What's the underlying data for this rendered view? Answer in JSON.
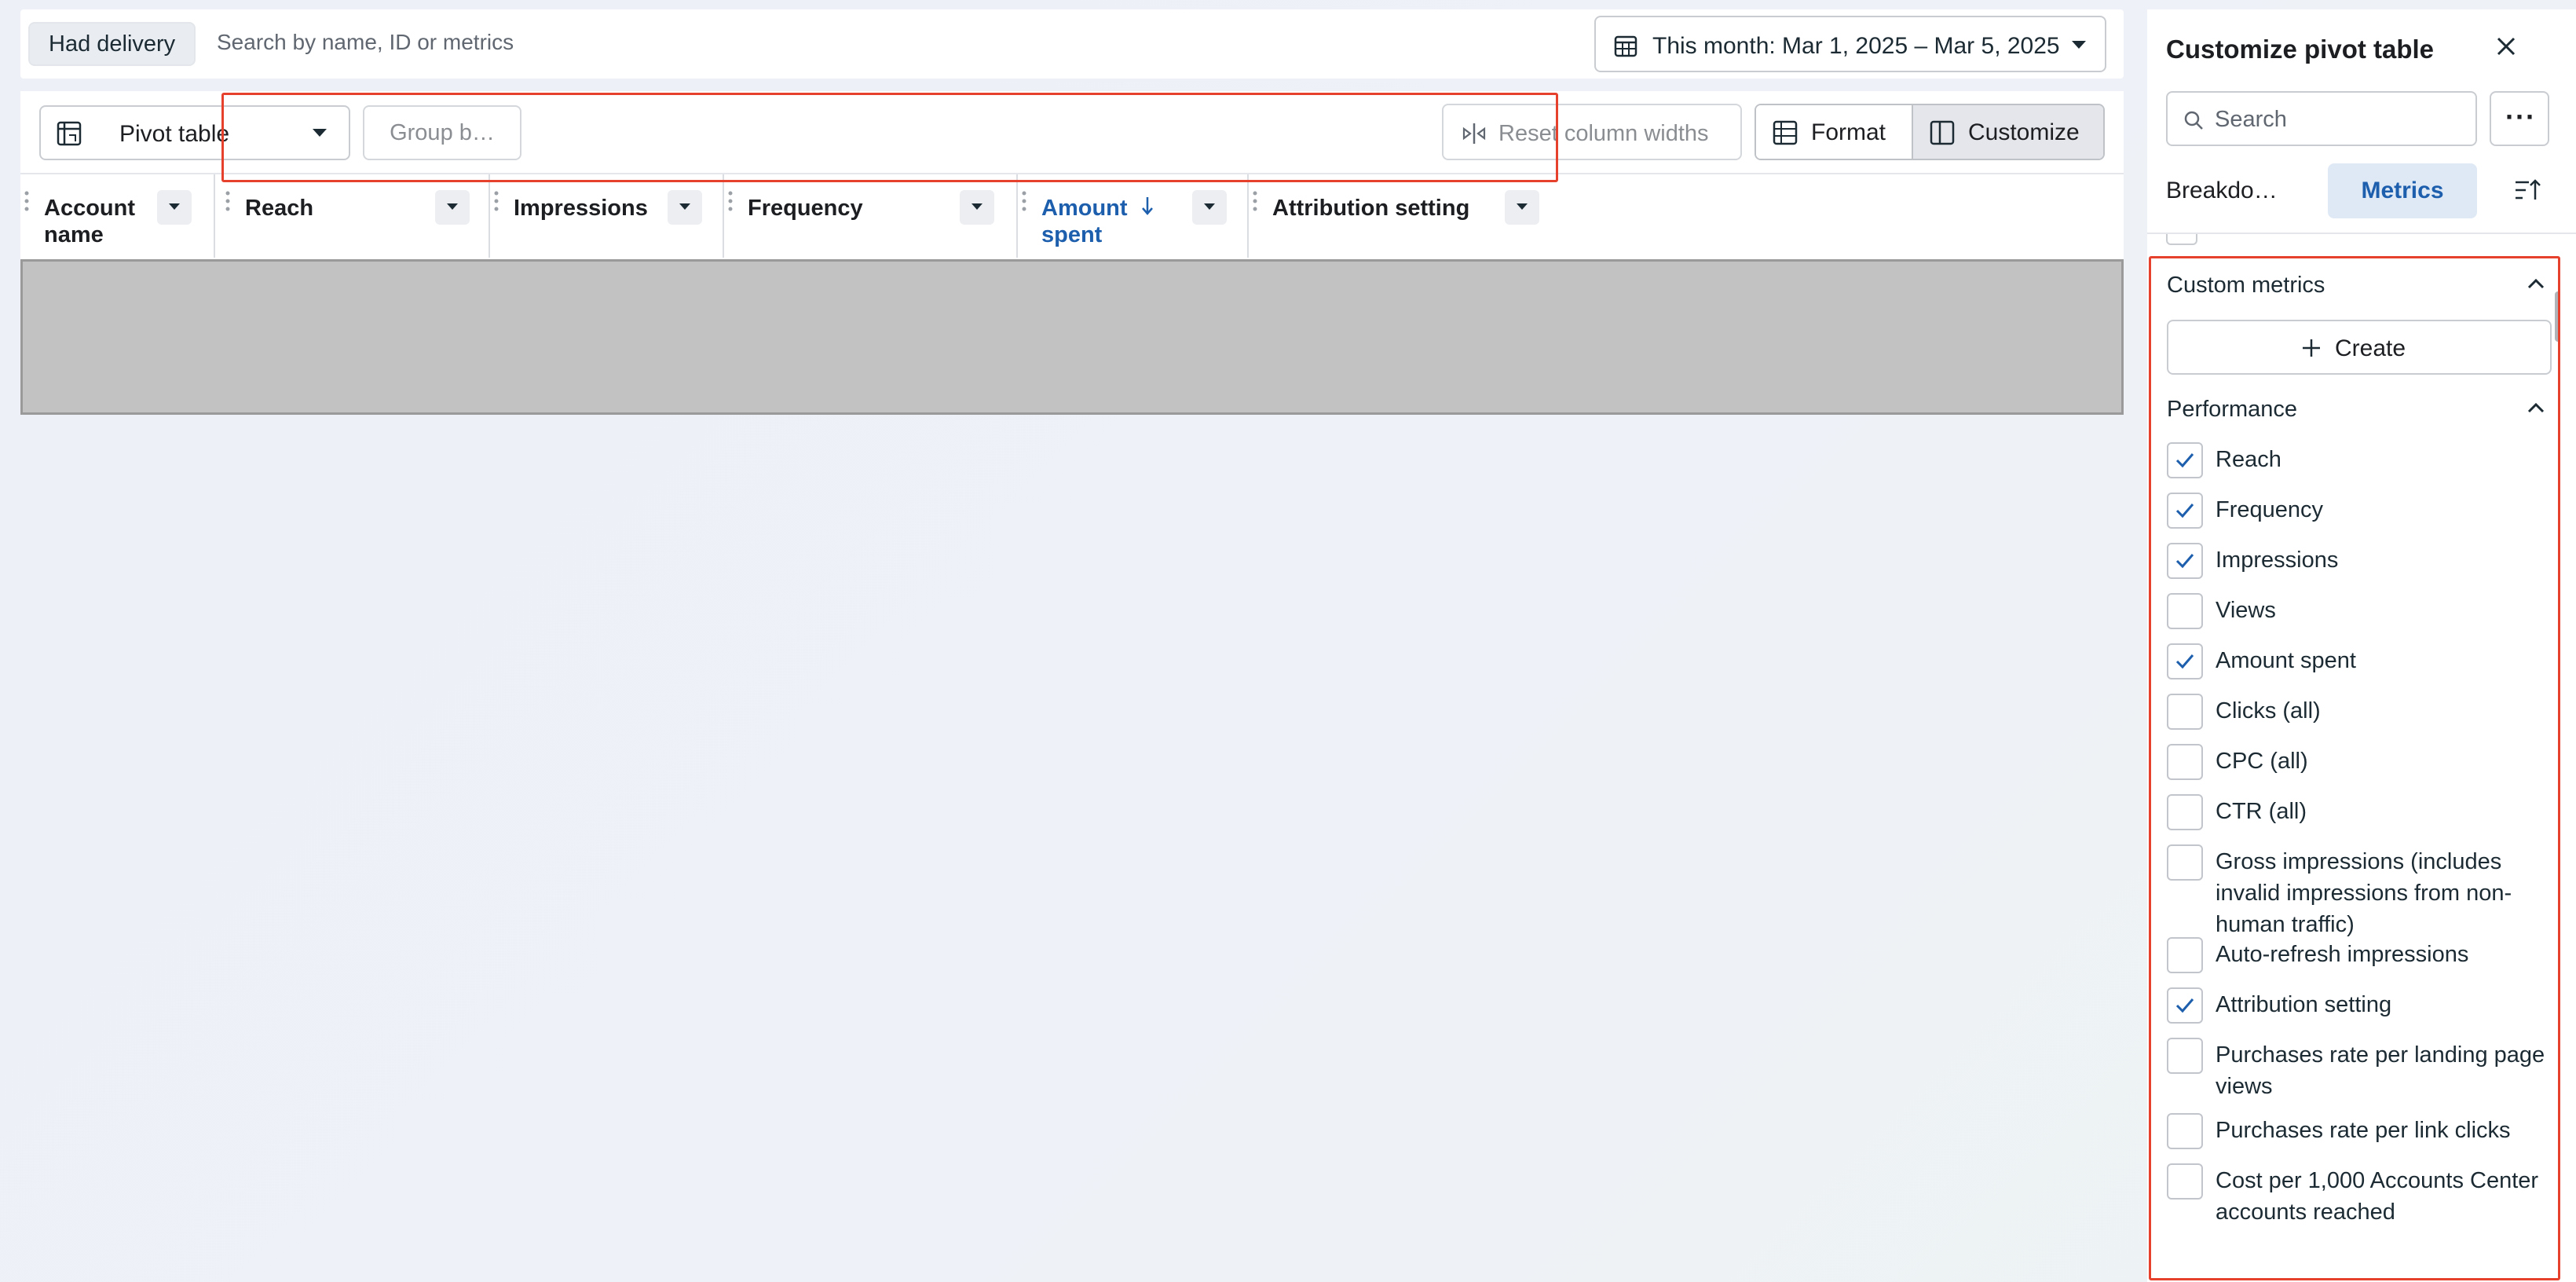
{
  "filter_bar": {
    "chip_label": "Had delivery",
    "search_placeholder": "Search by name, ID or metrics",
    "date_range_label": "This month: Mar 1, 2025 – Mar 5, 2025"
  },
  "toolbar": {
    "view_label": "Pivot table",
    "group_by_label": "Group b…",
    "reset_columns_label": "Reset column widths",
    "format_label": "Format",
    "customize_label": "Customize"
  },
  "table": {
    "columns": [
      {
        "label": "Account name"
      },
      {
        "label": "Reach"
      },
      {
        "label": "Impressions"
      },
      {
        "label": "Frequency"
      },
      {
        "label": "Amount spent",
        "sorted": "descending",
        "color": "#1d5fad"
      },
      {
        "label": "Attribution setting"
      }
    ]
  },
  "customize_panel": {
    "title": "Customize pivot table",
    "search_placeholder": "Search",
    "tabs": [
      {
        "label": "Breakdo…",
        "active": false
      },
      {
        "label": "Metrics",
        "active": true
      }
    ],
    "sections": [
      {
        "title": "Custom metrics",
        "expanded": true,
        "create_label": "Create"
      },
      {
        "title": "Performance",
        "expanded": true
      }
    ],
    "metrics": [
      {
        "label": "Reach",
        "checked": true
      },
      {
        "label": "Frequency",
        "checked": true
      },
      {
        "label": "Impressions",
        "checked": true
      },
      {
        "label": "Views",
        "checked": false
      },
      {
        "label": "Amount spent",
        "checked": true
      },
      {
        "label": "Clicks (all)",
        "checked": false
      },
      {
        "label": "CPC (all)",
        "checked": false
      },
      {
        "label": "CTR (all)",
        "checked": false
      },
      {
        "label": "Gross impressions (includes invalid impressions from non-human traffic)",
        "checked": false
      },
      {
        "label": "Auto-refresh impressions",
        "checked": false
      },
      {
        "label": "Attribution setting",
        "checked": true
      },
      {
        "label": "Purchases rate per landing page views",
        "checked": false
      },
      {
        "label": "Purchases rate per link clicks",
        "checked": false
      },
      {
        "label": "Cost per 1,000 Accounts Center accounts reached",
        "checked": false
      }
    ]
  },
  "colors": {
    "highlight": "#e5412d",
    "accent": "#1d5fad",
    "check": "#1d5fad"
  }
}
